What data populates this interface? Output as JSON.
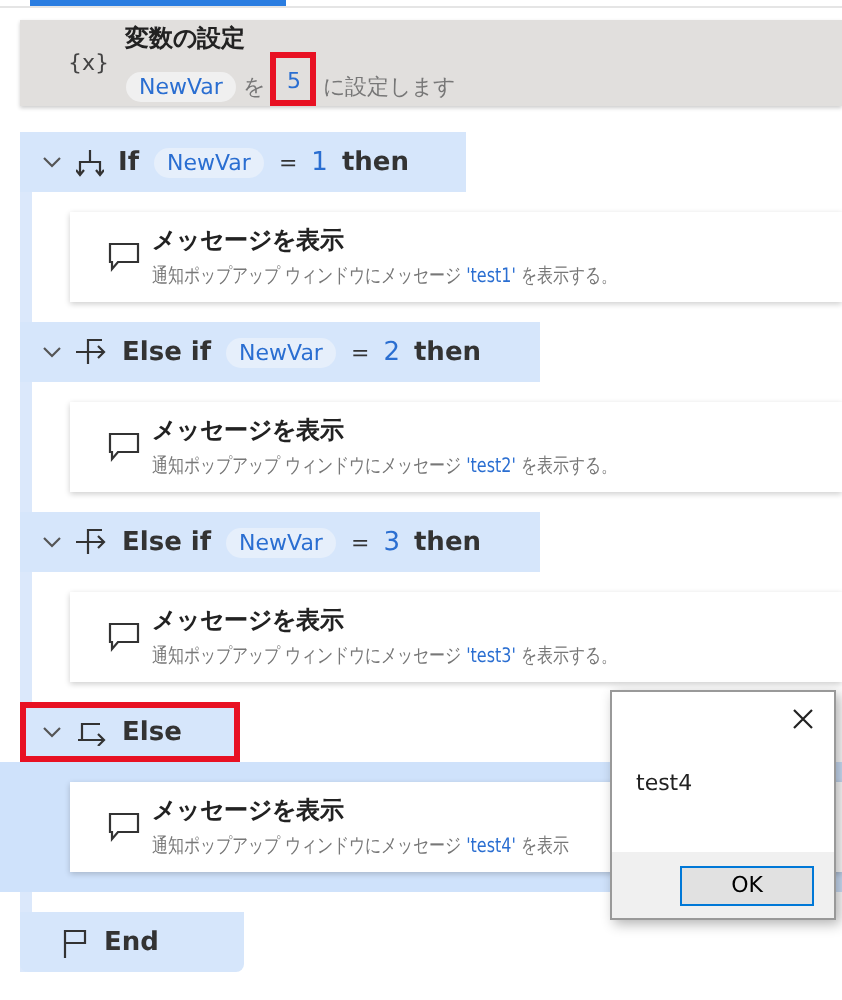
{
  "set_variable": {
    "icon": "{x}",
    "title": "変数の設定",
    "variable": "NewVar",
    "prefix": "を",
    "value": "5",
    "suffix": "に設定します",
    "value_highlighted": true
  },
  "branches": [
    {
      "kind": "if",
      "keyword": "If",
      "variable": "NewVar",
      "operator": "=",
      "value": "1",
      "then": "then",
      "highlighted": false,
      "steps": [
        {
          "title": "メッセージを表示",
          "text_before": "通知ポップアップ ウィンドウにメッセージ",
          "message": "'test1'",
          "text_after": "を表示する。",
          "selected": false
        }
      ]
    },
    {
      "kind": "elseif",
      "keyword": "Else if",
      "variable": "NewVar",
      "operator": "=",
      "value": "2",
      "then": "then",
      "highlighted": false,
      "steps": [
        {
          "title": "メッセージを表示",
          "text_before": "通知ポップアップ ウィンドウにメッセージ",
          "message": "'test2'",
          "text_after": "を表示する。",
          "selected": false
        }
      ]
    },
    {
      "kind": "elseif",
      "keyword": "Else if",
      "variable": "NewVar",
      "operator": "=",
      "value": "3",
      "then": "then",
      "highlighted": false,
      "steps": [
        {
          "title": "メッセージを表示",
          "text_before": "通知ポップアップ ウィンドウにメッセージ",
          "message": "'test3'",
          "text_after": "を表示する。",
          "selected": false
        }
      ]
    },
    {
      "kind": "else",
      "keyword": "Else",
      "highlighted": true,
      "steps": [
        {
          "title": "メッセージを表示",
          "text_before": "通知ポップアップ ウィンドウにメッセージ",
          "message": "'test4'",
          "text_after": "を表示",
          "selected": true
        }
      ]
    }
  ],
  "end": {
    "label": "End"
  },
  "dialog": {
    "message": "test4",
    "button": "OK"
  }
}
